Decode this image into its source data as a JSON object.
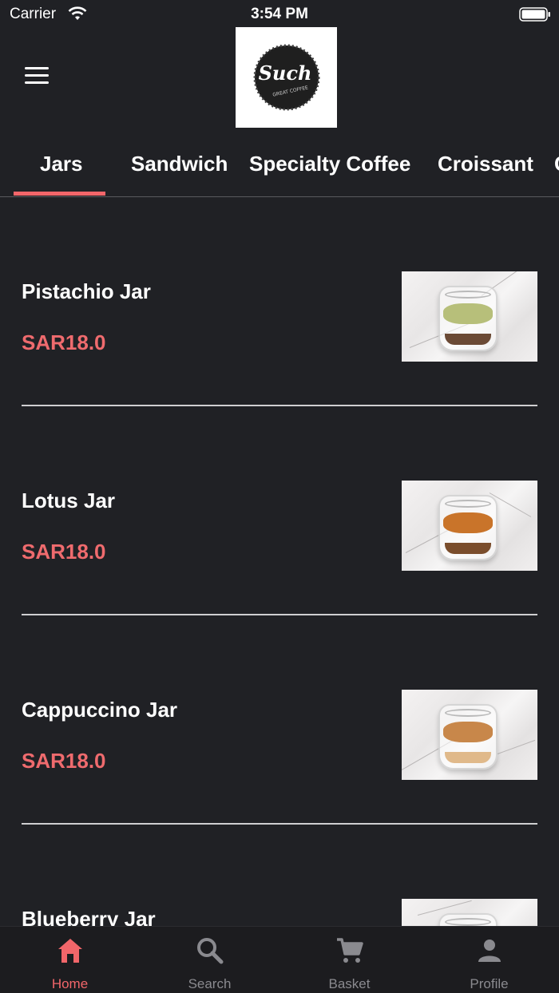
{
  "status_bar": {
    "carrier": "Carrier",
    "time": "3:54 PM"
  },
  "header": {
    "logo": {
      "text": "Such",
      "subtext": "GREAT COFFEE"
    }
  },
  "tabs": [
    {
      "label": "Jars",
      "active": true
    },
    {
      "label": "Sandwich"
    },
    {
      "label": "Specialty Coffee"
    },
    {
      "label": "Croissant"
    },
    {
      "label": "C"
    }
  ],
  "products": [
    {
      "name": "Pistachio Jar",
      "price": "SAR18.0",
      "image": "pistachio-jar-photo"
    },
    {
      "name": "Lotus Jar",
      "price": "SAR18.0",
      "image": "lotus-jar-photo"
    },
    {
      "name": "Cappuccino Jar",
      "price": "SAR18.0",
      "image": "cappuccino-jar-photo"
    },
    {
      "name": "Blueberry Jar",
      "price": "",
      "image": "blueberry-jar-photo"
    }
  ],
  "tabbar": [
    {
      "label": "Home",
      "icon": "home-icon",
      "active": true
    },
    {
      "label": "Search",
      "icon": "search-icon"
    },
    {
      "label": "Basket",
      "icon": "cart-icon"
    },
    {
      "label": "Profile",
      "icon": "person-icon"
    }
  ],
  "colors": {
    "accent": "#f2666a",
    "price": "#ef6b6e",
    "background": "#202125",
    "inactive": "#8a8a8f"
  }
}
